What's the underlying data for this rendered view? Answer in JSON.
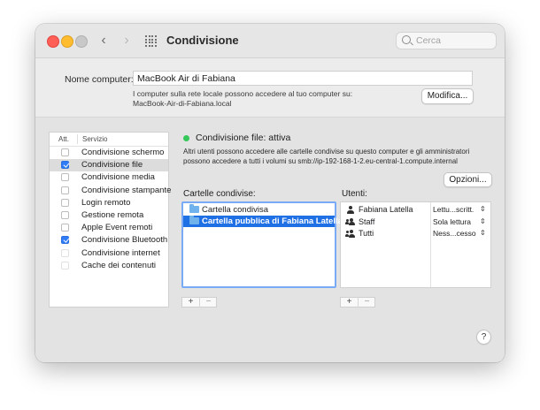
{
  "window": {
    "title": "Condivisione",
    "search_placeholder": "Cerca"
  },
  "toolbar": {
    "back": "‹",
    "forward": "›"
  },
  "computer_name": {
    "label": "Nome computer:",
    "value": "MacBook Air di Fabiana",
    "info_line1": "I computer sulla rete locale possono accedere al tuo computer su:",
    "info_line2": "MacBook-Air-di-Fabiana.local",
    "edit_button": "Modifica..."
  },
  "services": {
    "header_on": "Att.",
    "header_service": "Servizio",
    "items": [
      {
        "label": "Condivisione schermo",
        "checked": false,
        "selected": false,
        "disabled": false
      },
      {
        "label": "Condivisione file",
        "checked": true,
        "selected": true,
        "disabled": false
      },
      {
        "label": "Condivisione media",
        "checked": false,
        "selected": false,
        "disabled": false
      },
      {
        "label": "Condivisione stampante",
        "checked": false,
        "selected": false,
        "disabled": false
      },
      {
        "label": "Login remoto",
        "checked": false,
        "selected": false,
        "disabled": false
      },
      {
        "label": "Gestione remota",
        "checked": false,
        "selected": false,
        "disabled": false
      },
      {
        "label": "Apple Event remoti",
        "checked": false,
        "selected": false,
        "disabled": false
      },
      {
        "label": "Condivisione Bluetooth",
        "checked": true,
        "selected": false,
        "disabled": false
      },
      {
        "label": "Condivisione internet",
        "checked": false,
        "selected": false,
        "disabled": true
      },
      {
        "label": "Cache dei contenuti",
        "checked": false,
        "selected": false,
        "disabled": true
      }
    ]
  },
  "status": {
    "text": "Condivisione file: attiva",
    "color": "#34c759",
    "description_line1": "Altri utenti possono accedere alle cartelle condivise su questo computer e gli amministratori",
    "description_line2": "possono accedere a tutti i volumi su smb://ip-192-168-1-2.eu-central-1.compute.internal",
    "options_button": "Opzioni..."
  },
  "shared_folders": {
    "label": "Cartelle condivise:",
    "items": [
      {
        "label": "Cartella condivisa",
        "selected": false
      },
      {
        "label": "Cartella pubblica di Fabiana Latella",
        "selected": true
      }
    ],
    "add": "+",
    "remove": "−"
  },
  "users": {
    "label": "Utenti:",
    "items": [
      {
        "name": "Fabiana Latella",
        "permission": "Lettu...scritt.",
        "icon": "user-icon"
      },
      {
        "name": "Staff",
        "permission": "Sola lettura",
        "icon": "group-icon"
      },
      {
        "name": "Tutti",
        "permission": "Ness...cesso",
        "icon": "group-icon"
      }
    ],
    "add": "+",
    "remove": "−"
  },
  "help_button": "?",
  "colors": {
    "accent": "#1f6fe5",
    "close": "#fe5f57",
    "minimize": "#febc2e",
    "zoom": "#c8c8c8"
  }
}
